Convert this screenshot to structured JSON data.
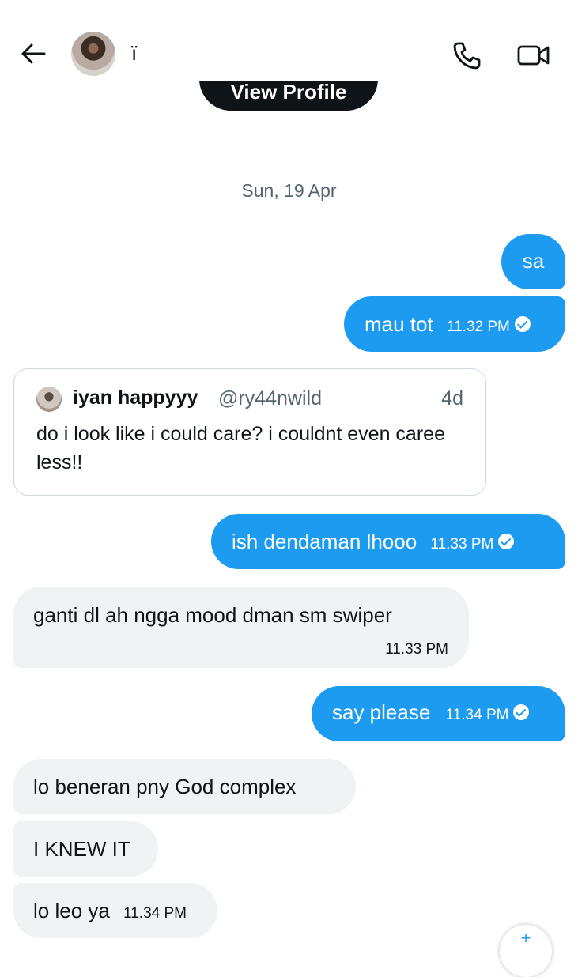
{
  "header": {
    "contact_name": "ï",
    "view_profile_label": "View Profile"
  },
  "date_separator": "Sun, 19 Apr",
  "messages": [
    {
      "direction": "out",
      "text": "sa",
      "time": ""
    },
    {
      "direction": "out",
      "text": "mau tot",
      "time": "11.32 PM"
    },
    {
      "direction": "out",
      "text": "ish dendaman lhooo",
      "time": "11.33 PM"
    },
    {
      "direction": "in",
      "text": "ganti dl ah ngga mood dman sm swiper",
      "time": "11.33 PM"
    },
    {
      "direction": "out",
      "text": "say please",
      "time": "11.34 PM"
    },
    {
      "direction": "in",
      "text": "lo beneran pny God complex",
      "time": ""
    },
    {
      "direction": "in",
      "text": "I KNEW IT",
      "time": ""
    },
    {
      "direction": "in",
      "text": "lo leo ya",
      "time": "11.34 PM"
    }
  ],
  "quoted_tweet": {
    "name": "iyan happyyy",
    "handle": "@ry44nwild",
    "age": "4d",
    "text": "do i look like i could care? i couldnt even caree less!!"
  },
  "colors": {
    "outgoing_bubble": "#1d9bf0",
    "incoming_bubble": "#eff3f4",
    "secondary_text": "#536471"
  },
  "icons": {
    "back": "arrow-left-icon",
    "call": "phone-icon",
    "video": "video-camera-icon",
    "read": "check-circle-icon"
  }
}
